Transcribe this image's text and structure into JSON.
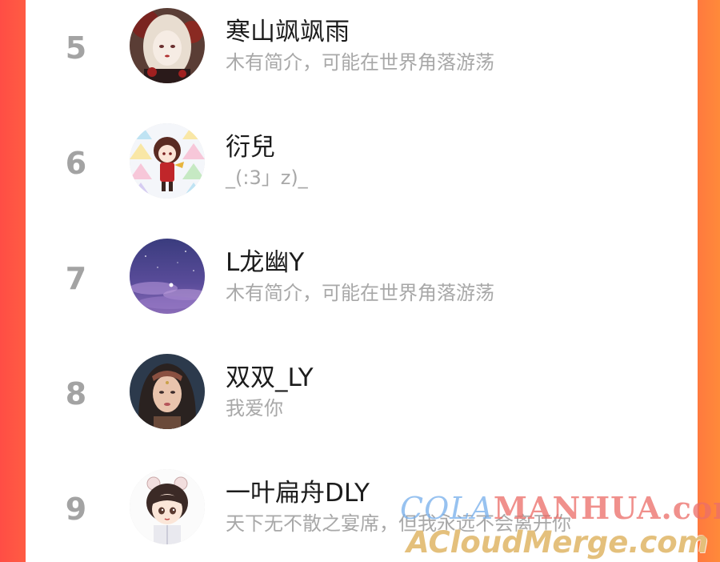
{
  "ranking": {
    "entries": [
      {
        "rank": "5",
        "name": "寒山飒飒雨",
        "bio": "木有简介，可能在世界角落游荡",
        "avatar_icon": "gothic-girl-avatar-icon"
      },
      {
        "rank": "6",
        "name": "衍兒",
        "bio": "_(:3」z)_",
        "avatar_icon": "chibi-character-avatar-icon"
      },
      {
        "rank": "7",
        "name": "L龙幽Y",
        "bio": "木有简介，可能在世界角落游荡",
        "avatar_icon": "night-sky-avatar-icon"
      },
      {
        "rank": "8",
        "name": "双双_LY",
        "bio": "我爱你",
        "avatar_icon": "portrait-girl-avatar-icon"
      },
      {
        "rank": "9",
        "name": "一叶扁舟DLY",
        "bio": "天下无不散之宴席，但我永远不会离开你",
        "avatar_icon": "cartoon-boy-avatar-icon"
      }
    ]
  },
  "watermark": {
    "line1_a": "COLA",
    "line1_b": "MANHUA",
    "line1_c": ".com",
    "line2": "ACloudMerge.com"
  },
  "colors": {
    "background_left": "#ff4d45",
    "background_right": "#ff8a3a",
    "rank_gray": "#a3a3a3",
    "name_text": "#1c1c1c",
    "bio_text": "#a8a8a8"
  }
}
